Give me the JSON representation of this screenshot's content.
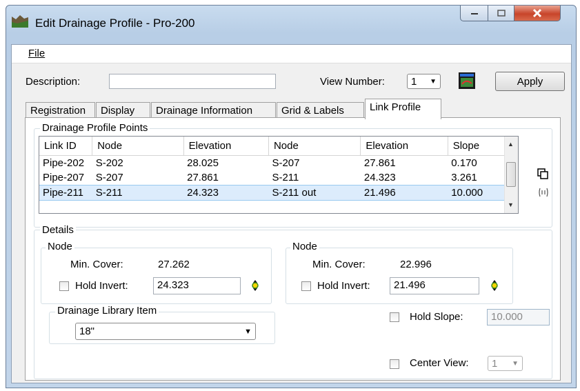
{
  "window": {
    "title": "Edit Drainage Profile - Pro-200"
  },
  "menu": {
    "file": "File"
  },
  "header": {
    "description_label": "Description:",
    "description_value": "",
    "view_number_label": "View Number:",
    "view_number_value": "1",
    "apply_label": "Apply"
  },
  "tabs": [
    "Registration",
    "Display",
    "Drainage Information",
    "Grid & Labels",
    "Link Profile"
  ],
  "active_tab": "Link Profile",
  "profile_points": {
    "title": "Drainage Profile Points",
    "columns": [
      "Link ID",
      "Node",
      "Elevation",
      "Node",
      "Elevation",
      "Slope"
    ],
    "rows": [
      [
        "Pipe-202",
        "S-202",
        "28.025",
        "S-207",
        "27.861",
        "0.170"
      ],
      [
        "Pipe-207",
        "S-207",
        "27.861",
        "S-211",
        "24.323",
        "3.261"
      ],
      [
        "Pipe-211",
        "S-211",
        "24.323",
        "S-211 out",
        "21.496",
        "10.000"
      ]
    ],
    "selected_row": 2
  },
  "details": {
    "title": "Details",
    "left_node": {
      "title": "Node",
      "min_cover_label": "Min. Cover:",
      "min_cover_value": "27.262",
      "hold_invert_label": "Hold Invert:",
      "hold_invert_value": "24.323"
    },
    "right_node": {
      "title": "Node",
      "min_cover_label": "Min. Cover:",
      "min_cover_value": "22.996",
      "hold_invert_label": "Hold Invert:",
      "hold_invert_value": "21.496"
    },
    "library": {
      "title": "Drainage Library Item",
      "value": "18\""
    },
    "hold_slope_label": "Hold Slope:",
    "hold_slope_value": "10.000",
    "center_view_label": "Center View:",
    "center_view_value": "1"
  },
  "colors": {
    "selection": "#dcecfc",
    "close_button": "#c8442a",
    "titlebar": "#c2d5ea"
  }
}
